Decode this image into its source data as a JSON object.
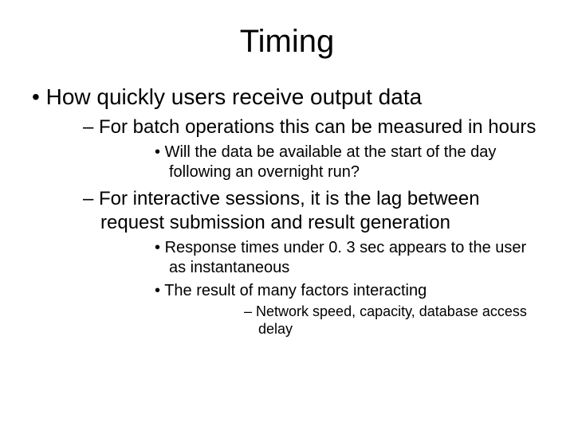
{
  "title": "Timing",
  "b1": "How quickly users receive output data",
  "b1_1": "For batch operations this can be measured in hours",
  "b1_1_1": "Will the data be available at the start of the day following an overnight run?",
  "b1_2": "For interactive sessions, it is the lag between request submission and result generation",
  "b1_2_1": "Response times under 0. 3 sec appears to the user as instantaneous",
  "b1_2_2": "The result of many factors interacting",
  "b1_2_2_1": "Network speed, capacity, database access delay"
}
